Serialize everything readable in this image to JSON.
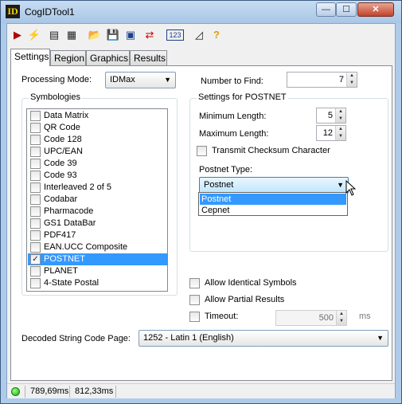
{
  "window": {
    "title": "CogIDTool1",
    "app_icon": "ID",
    "min_symbol": "—",
    "max_symbol": "☐",
    "close_symbol": "✕"
  },
  "toolbar": [
    {
      "name": "run-icon",
      "glyph": "▶",
      "color": "#b00000"
    },
    {
      "name": "lightning-icon",
      "glyph": "⚡",
      "color": "#d8a000"
    },
    {
      "name": "id-barcode-icon",
      "glyph": "▤",
      "color": "#222222"
    },
    {
      "name": "id-settings-icon",
      "glyph": "▦",
      "color": "#222222"
    },
    {
      "name": "open-folder-icon",
      "glyph": "📂",
      "color": "#c89a1b"
    },
    {
      "name": "save-icon",
      "glyph": "💾",
      "color": "#1b3f8a"
    },
    {
      "name": "image-source-icon",
      "glyph": "▣",
      "color": "#1b3f8a"
    },
    {
      "name": "train-icon",
      "glyph": "⇄",
      "color": "#c00000"
    },
    {
      "name": "numeric-123-icon",
      "glyph": "123",
      "color": "#1b3f8a"
    },
    {
      "name": "graphics-icon",
      "glyph": "◿",
      "color": "#222222"
    },
    {
      "name": "help-icon",
      "glyph": "?",
      "color": "#d8a000"
    }
  ],
  "tabs": [
    "Settings",
    "Region",
    "Graphics",
    "Results"
  ],
  "settings": {
    "processing_mode_label": "Processing Mode:",
    "processing_mode_value": "IDMax",
    "number_to_find_label": "Number to Find:",
    "number_to_find_value": "7",
    "symbologies_title": "Symbologies",
    "symbologies": [
      {
        "label": "Data Matrix",
        "checked": false
      },
      {
        "label": "QR Code",
        "checked": false
      },
      {
        "label": "Code 128",
        "checked": false
      },
      {
        "label": "UPC/EAN",
        "checked": false
      },
      {
        "label": "Code 39",
        "checked": false
      },
      {
        "label": "Code 93",
        "checked": false
      },
      {
        "label": "Interleaved 2 of 5",
        "checked": false
      },
      {
        "label": "Codabar",
        "checked": false
      },
      {
        "label": "Pharmacode",
        "checked": false
      },
      {
        "label": "GS1 DataBar",
        "checked": false
      },
      {
        "label": "PDF417",
        "checked": false
      },
      {
        "label": "EAN.UCC Composite",
        "checked": false
      },
      {
        "label": "POSTNET",
        "checked": true
      },
      {
        "label": "PLANET",
        "checked": false
      },
      {
        "label": "4-State Postal",
        "checked": false
      }
    ],
    "postnet_group_title": "Settings for POSTNET",
    "min_length_label": "Minimum Length:",
    "min_length_value": "5",
    "max_length_label": "Maximum Length:",
    "max_length_value": "12",
    "transmit_checksum_label": "Transmit Checksum Character",
    "postnet_type_label": "Postnet Type:",
    "postnet_type_value": "Postnet",
    "postnet_type_options": [
      "Postnet",
      "Cepnet"
    ],
    "allow_identical_label": "Allow Identical Symbols",
    "allow_partial_label": "Allow Partial Results",
    "timeout_label": "Timeout:",
    "timeout_value": "500",
    "timeout_unit": "ms",
    "code_page_label": "Decoded String Code Page:",
    "code_page_value": "1252 - Latin 1 (English)"
  },
  "status": {
    "time1": "789,69ms",
    "time2": "812,33ms"
  }
}
